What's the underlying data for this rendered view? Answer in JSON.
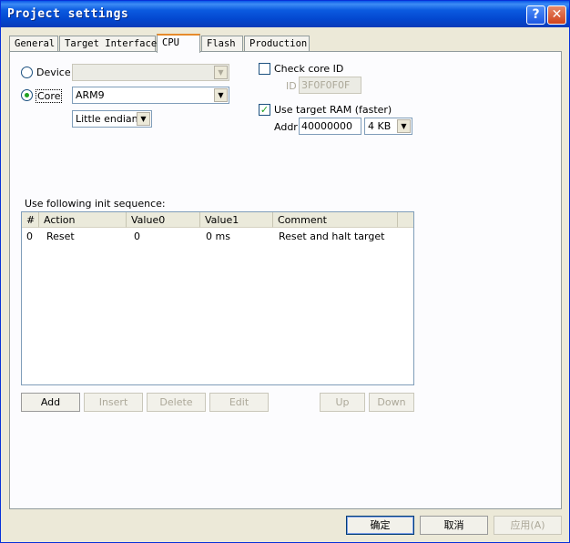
{
  "window": {
    "title": "Project settings",
    "help_glyph": "?",
    "close_glyph": "✕"
  },
  "tabs": [
    {
      "label": "General"
    },
    {
      "label": "Target Interface"
    },
    {
      "label": "CPU",
      "active": true
    },
    {
      "label": "Flash"
    },
    {
      "label": "Production"
    }
  ],
  "cpu": {
    "device_label": "Device",
    "device_value": "",
    "device_selected": false,
    "core_label": "Core",
    "core_selected": true,
    "core_value": "ARM9",
    "endian_value": "Little endian",
    "check_core_id_label": "Check core ID",
    "check_core_id_checked": false,
    "id_label": "ID",
    "id_value": "3F0F0F0F",
    "use_target_ram_label": "Use target RAM (faster)",
    "use_target_ram_checked": true,
    "addr_label": "Addr",
    "addr_value": "40000000",
    "ram_size_value": "4 KB",
    "init_sequence_label": "Use following init sequence:"
  },
  "init_table": {
    "columns": [
      "#",
      "Action",
      "Value0",
      "Value1",
      "Comment"
    ],
    "rows": [
      [
        "0",
        "Reset",
        "0",
        "0 ms",
        "Reset and halt target"
      ]
    ]
  },
  "seq_buttons": {
    "add": "Add",
    "insert": "Insert",
    "delete": "Delete",
    "edit": "Edit",
    "up": "Up",
    "down": "Down"
  },
  "dialog_buttons": {
    "ok": "确定",
    "cancel": "取消",
    "apply": "应用(A)"
  },
  "colors": {
    "title_bar": "#0a58e8",
    "dialog_bg": "#ece9d8",
    "check_mark": "#21a121"
  },
  "icons": {
    "dropdown": "▼",
    "check": "✓"
  }
}
